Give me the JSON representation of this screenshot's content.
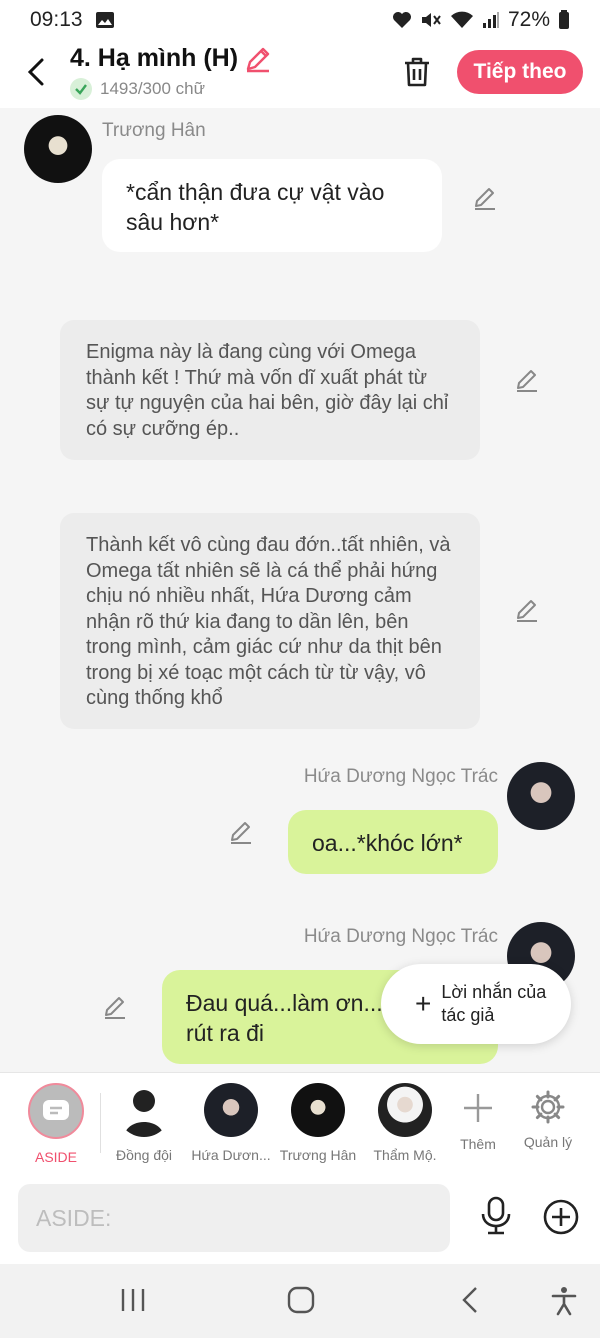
{
  "status_bar": {
    "time": "09:13",
    "battery": "72%"
  },
  "header": {
    "title": "4. Hạ mình (H)",
    "word_count": "1493/300 chữ",
    "next_button": "Tiếp theo"
  },
  "messages": [
    {
      "sender": "Trương Hân",
      "text": "*cẩn thận đưa cự vật vào sâu hơn*"
    },
    {
      "text": "Enigma này là đang cùng với Omega thành kết ! Thứ mà vốn dĩ xuất phát từ sự tự nguyện của hai bên, giờ đây lại chỉ có sự cưỡng ép.."
    },
    {
      "text": "Thành kết vô cùng đau đớn..tất nhiên, và Omega tất nhiên sẽ là cá thể phải hứng chịu nó nhiều nhất, Hứa Dương cảm nhận rõ thứ kia đang to dần lên, bên trong mình, cảm giác cứ như da thịt bên trong bị xé toạc một cách từ từ vậy, vô cùng thống khổ"
    },
    {
      "sender": "Hứa Dương Ngọc Trác",
      "text": "oa...*khóc lớn*"
    },
    {
      "sender": "Hứa Dương Ngọc Trác",
      "text": "Đau quá...làm ơn...\nrút ra đi"
    }
  ],
  "author_note_button": "Lời nhắn của tác giả",
  "characters": [
    {
      "label": "ASIDE"
    },
    {
      "label": "Đồng đội"
    },
    {
      "label": "Hứa Dươn..."
    },
    {
      "label": "Trương Hân"
    },
    {
      "label": "Thẩm Mộ."
    },
    {
      "label": "Thêm"
    },
    {
      "label": "Quản lý"
    }
  ],
  "input": {
    "placeholder": "ASIDE:"
  },
  "colors": {
    "accent": "#f0506e",
    "player_bubble": "#d9f39a",
    "narration_bubble": "#ececec"
  }
}
